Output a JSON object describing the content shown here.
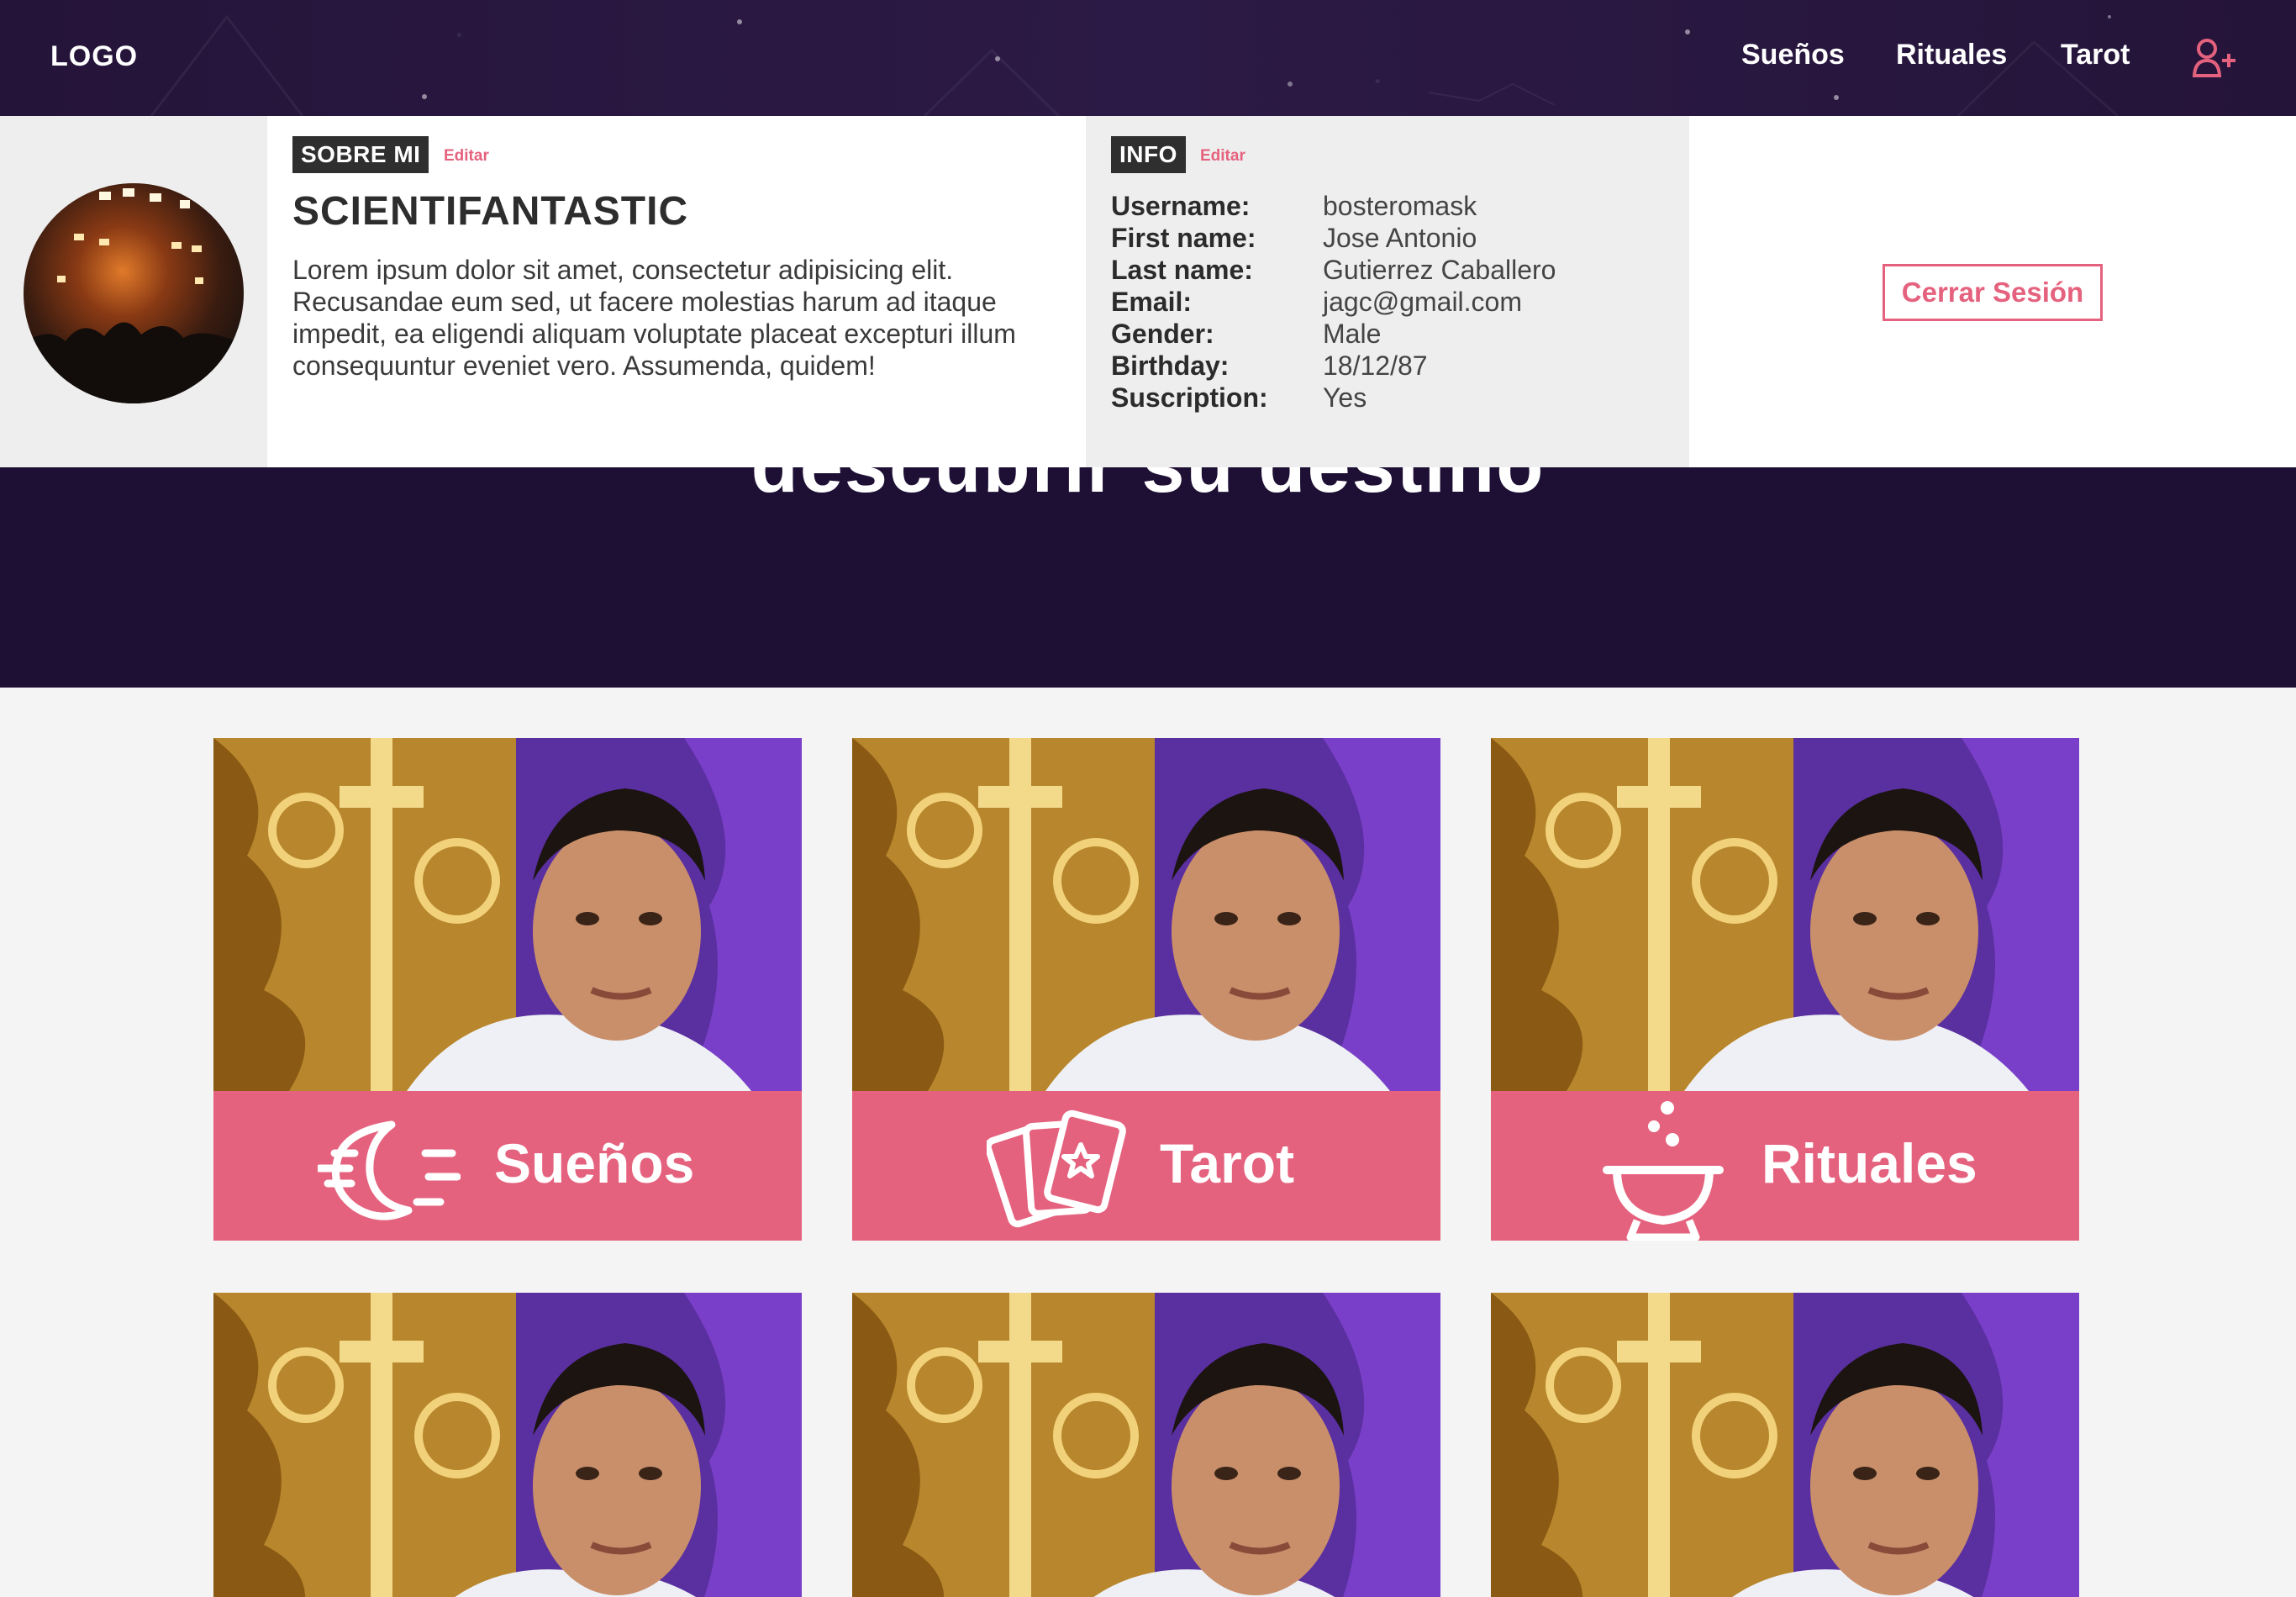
{
  "nav": {
    "logo": "LOGO",
    "links": [
      "Sueños",
      "Rituales",
      "Tarot"
    ],
    "add_user_icon": "add-user-icon"
  },
  "profile": {
    "about_tag": "SOBRE MI",
    "about_edit": "Editar",
    "about_title": "SCIENTIFANTASTIC",
    "about_text": "Lorem ipsum dolor sit amet, consectetur adipisicing elit. Recusandae eum sed, ut facere molestias harum ad itaque impedit, ea eligendi aliquam voluptate placeat excepturi illum consequuntur eveniet vero. Assumenda, quidem!",
    "info_tag": "INFO",
    "info_edit": "Editar",
    "info": [
      {
        "key": "Username:",
        "value": "bosteromask"
      },
      {
        "key": "First name:",
        "value": "Jose Antonio"
      },
      {
        "key": "Last name:",
        "value": "Gutierrez Caballero"
      },
      {
        "key": "Email:",
        "value": "jagc@gmail.com"
      },
      {
        "key": "Gender:",
        "value": "Male"
      },
      {
        "key": "Birthday:",
        "value": "18/12/87"
      },
      {
        "key": "Suscription:",
        "value": "Yes"
      }
    ],
    "logout": "Cerrar Sesión"
  },
  "hero": {
    "title": "descubrir su destino"
  },
  "cards": [
    {
      "label": "Sueños",
      "icon": "moon-icon"
    },
    {
      "label": "Tarot",
      "icon": "tarot-cards-icon"
    },
    {
      "label": "Rituales",
      "icon": "cauldron-icon"
    },
    {
      "label": "",
      "icon": ""
    },
    {
      "label": "",
      "icon": ""
    },
    {
      "label": "",
      "icon": ""
    }
  ],
  "colors": {
    "accent": "#e5627e",
    "nav_bg": "#26163d",
    "hero_bg": "#1e0f34",
    "page_bg": "#f4f4f4"
  }
}
